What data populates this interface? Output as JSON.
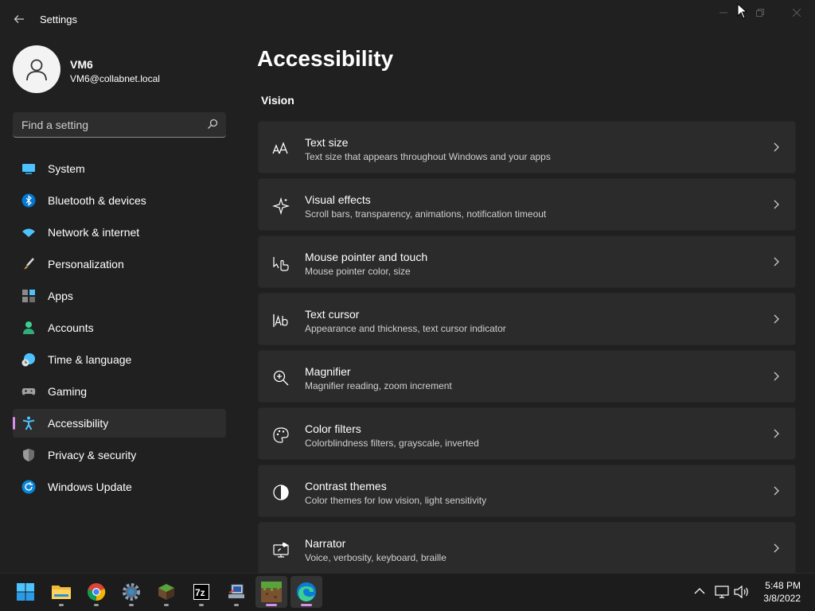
{
  "window": {
    "title": "Settings",
    "controls": {
      "minimize": "minimize-icon",
      "maximize": "maximize-icon",
      "close": "close-icon"
    }
  },
  "profile": {
    "name": "VM6",
    "email": "VM6@collabnet.local"
  },
  "search": {
    "placeholder": "Find a setting"
  },
  "sidebar": {
    "items": [
      {
        "label": "System",
        "icon": "system-icon",
        "color": "#4cc2ff"
      },
      {
        "label": "Bluetooth & devices",
        "icon": "bluetooth-icon",
        "color": "#0078d4"
      },
      {
        "label": "Network & internet",
        "icon": "wifi-icon",
        "color": "#4cc2ff"
      },
      {
        "label": "Personalization",
        "icon": "brush-icon",
        "color": "#e8a24a"
      },
      {
        "label": "Apps",
        "icon": "apps-icon",
        "color": "#a0a0a0"
      },
      {
        "label": "Accounts",
        "icon": "accounts-icon",
        "color": "#3ccf91"
      },
      {
        "label": "Time & language",
        "icon": "globe-clock-icon",
        "color": "#4cc2ff"
      },
      {
        "label": "Gaming",
        "icon": "gamepad-icon",
        "color": "#a0a0a0"
      },
      {
        "label": "Accessibility",
        "icon": "accessibility-icon",
        "color": "#4cc2ff",
        "selected": true
      },
      {
        "label": "Privacy & security",
        "icon": "shield-icon",
        "color": "#a0a0a0"
      },
      {
        "label": "Windows Update",
        "icon": "update-icon",
        "color": "#4cc2ff"
      }
    ]
  },
  "main": {
    "title": "Accessibility",
    "section": "Vision",
    "cards": [
      {
        "title": "Text size",
        "desc": "Text size that appears throughout Windows and your apps",
        "icon": "text-size-icon"
      },
      {
        "title": "Visual effects",
        "desc": "Scroll bars, transparency, animations, notification timeout",
        "icon": "sparkle-icon"
      },
      {
        "title": "Mouse pointer and touch",
        "desc": "Mouse pointer color, size",
        "icon": "pointer-touch-icon"
      },
      {
        "title": "Text cursor",
        "desc": "Appearance and thickness, text cursor indicator",
        "icon": "text-cursor-icon"
      },
      {
        "title": "Magnifier",
        "desc": "Magnifier reading, zoom increment",
        "icon": "magnifier-icon"
      },
      {
        "title": "Color filters",
        "desc": "Colorblindness filters, grayscale, inverted",
        "icon": "palette-icon"
      },
      {
        "title": "Contrast themes",
        "desc": "Color themes for low vision, light sensitivity",
        "icon": "contrast-icon"
      },
      {
        "title": "Narrator",
        "desc": "Voice, verbosity, keyboard, braille",
        "icon": "narrator-icon"
      }
    ]
  },
  "taskbar": {
    "apps": [
      {
        "name": "start-icon"
      },
      {
        "name": "file-explorer-icon"
      },
      {
        "name": "chrome-icon"
      },
      {
        "name": "settings-gear-icon"
      },
      {
        "name": "minecraft-icon"
      },
      {
        "name": "7zip-icon"
      },
      {
        "name": "network-tool-icon"
      },
      {
        "name": "minecraft-grass-icon"
      },
      {
        "name": "edge-icon"
      }
    ],
    "tray": {
      "chevron": "chevron-up-icon",
      "network": "network-icon",
      "volume": "volume-icon"
    },
    "clock": {
      "time": "5:48 PM",
      "date": "3/8/2022"
    }
  },
  "colors": {
    "background": "#202020",
    "card": "#2b2b2b",
    "accent": "#d78ee7",
    "brand": "#0078d4"
  }
}
